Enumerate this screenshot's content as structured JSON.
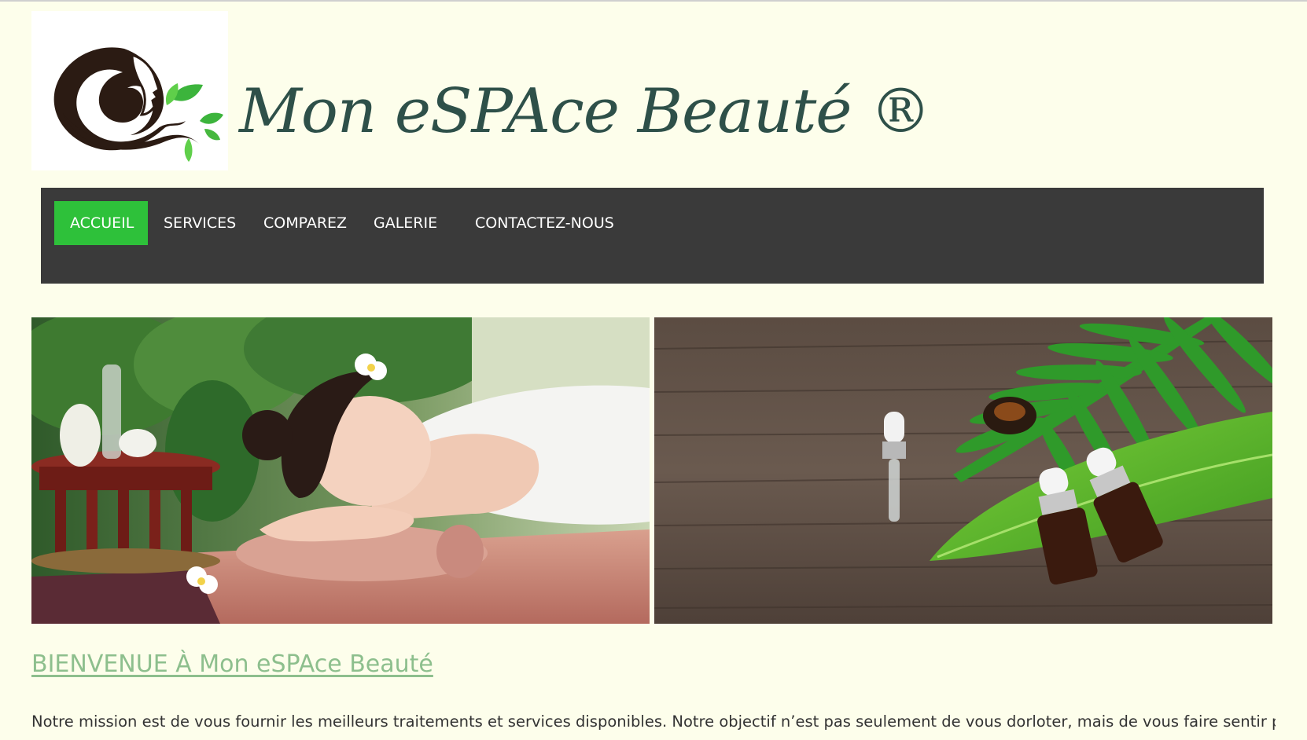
{
  "site": {
    "title": "Mon eSPAce Beauté ®",
    "logo_icon": "woman-silhouette-leaves-logo"
  },
  "nav": {
    "items": [
      {
        "label": "ACCUEIL",
        "active": true
      },
      {
        "label": "SERVICES",
        "active": false
      },
      {
        "label": "COMPAREZ",
        "active": false
      },
      {
        "label": "GALERIE",
        "active": false
      },
      {
        "label": "CONTACTEZ-NOUS",
        "active": false
      }
    ]
  },
  "hero": {
    "images": [
      "spa-massage-woman-photo",
      "essential-oil-bottles-leaves-photo"
    ]
  },
  "content": {
    "heading": "BIENVENUE À Mon eSPAce Beauté",
    "mission": "Notre mission est de vous fournir les meilleurs traitements et services disponibles. Notre objectif n’est pas seulement de vous dorloter, mais de vous faire sentir plus"
  },
  "colors": {
    "page_bg": "#fdfeeb",
    "nav_bg": "#3a3a3a",
    "nav_active": "#2ec13a",
    "title": "#2e5049",
    "heading_link": "#8dbf8d"
  }
}
